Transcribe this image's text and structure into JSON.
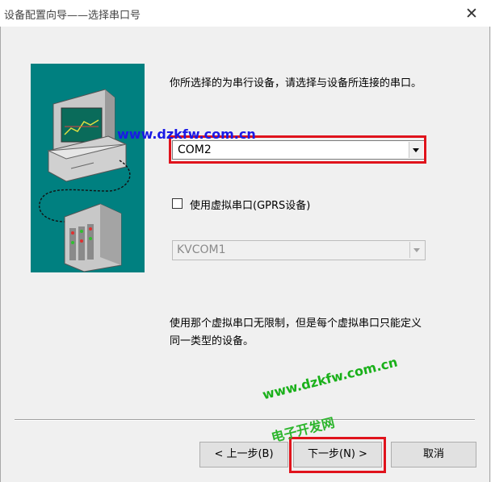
{
  "window": {
    "title": "设备配置向导——选择串口号",
    "close_glyph": "✕"
  },
  "main": {
    "instruction": "你所选择的为串行设备，请选择与设备所连接的串口。",
    "port_combo": {
      "value": "COM2"
    },
    "virtual_port_checkbox": {
      "label": "使用虚拟串口(GPRS设备)",
      "checked": false
    },
    "virtual_port_combo": {
      "value": "KVCOM1",
      "disabled": true
    },
    "note": "使用那个虚拟串口无限制，但是每个虚拟串口只能定义同一类型的设备。"
  },
  "buttons": {
    "prev": "< 上一步(B)",
    "next": "下一步(N) >",
    "cancel": "取消"
  },
  "watermarks": {
    "top": "www.dzkfw.com.cn",
    "bottom_url": "www.dzkfw.com.cn",
    "bottom_name": "电子开发网"
  },
  "colors": {
    "illustration_bg": "#008080",
    "highlight_red": "#e0131c"
  }
}
